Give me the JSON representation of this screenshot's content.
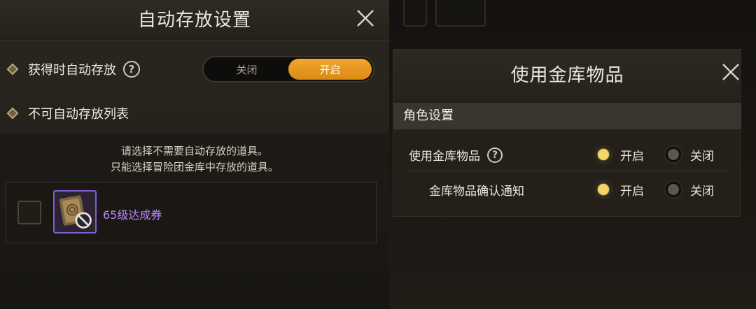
{
  "auto_store": {
    "title": "自动存放设置",
    "auto_store_label": "获得时自动存放",
    "help_glyph": "?",
    "toggle": {
      "off_label": "关闭",
      "on_label": "开启",
      "selected": "on"
    },
    "exclusion_label": "不可自动存放列表",
    "hint_line1": "请选择不需要自动存放的道具。",
    "hint_line2": "只能选择冒险团金库中存放的道具。",
    "items": [
      {
        "name": "65级达成券",
        "checked": false,
        "icon": "ticket-icon",
        "status_icon": "prohibited-icon"
      }
    ]
  },
  "vault": {
    "title": "使用金库物品",
    "section": "角色设置",
    "rows": [
      {
        "label": "使用金库物品",
        "help_glyph": "?",
        "on_label": "开启",
        "off_label": "关闭",
        "selected": "on"
      },
      {
        "label": "金库物品确认通知",
        "on_label": "开启",
        "off_label": "关闭",
        "selected": "on"
      }
    ]
  },
  "colors": {
    "accent_orange": "#f0a22c",
    "radio_active": "#f3d56c",
    "item_purple": "#b987ff"
  }
}
